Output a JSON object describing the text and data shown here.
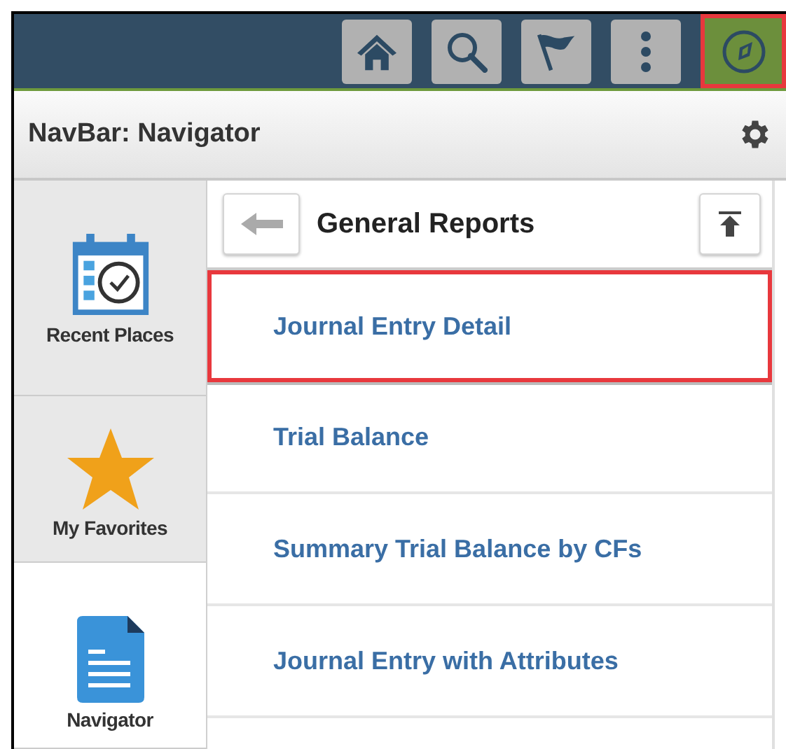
{
  "header": {
    "buttons": [
      {
        "kind": "home",
        "selected": false
      },
      {
        "kind": "search",
        "selected": false
      },
      {
        "kind": "flag",
        "selected": false
      },
      {
        "kind": "more",
        "selected": false
      },
      {
        "kind": "navigator",
        "selected": true
      }
    ]
  },
  "title_bar": {
    "title": "NavBar: Navigator"
  },
  "sidebar": {
    "items": [
      {
        "kind": "recent",
        "label": "Recent Places",
        "selected": false
      },
      {
        "kind": "favorites",
        "label": "My Favorites",
        "selected": false
      },
      {
        "kind": "navigator",
        "label": "Navigator",
        "selected": true
      }
    ]
  },
  "panel": {
    "title": "General Reports",
    "items": [
      {
        "label": "Journal Entry Detail",
        "selected": true
      },
      {
        "label": "Trial Balance",
        "selected": false
      },
      {
        "label": "Summary Trial Balance by CFs",
        "selected": false
      },
      {
        "label": "Journal Entry with Attributes",
        "selected": false
      }
    ]
  }
}
